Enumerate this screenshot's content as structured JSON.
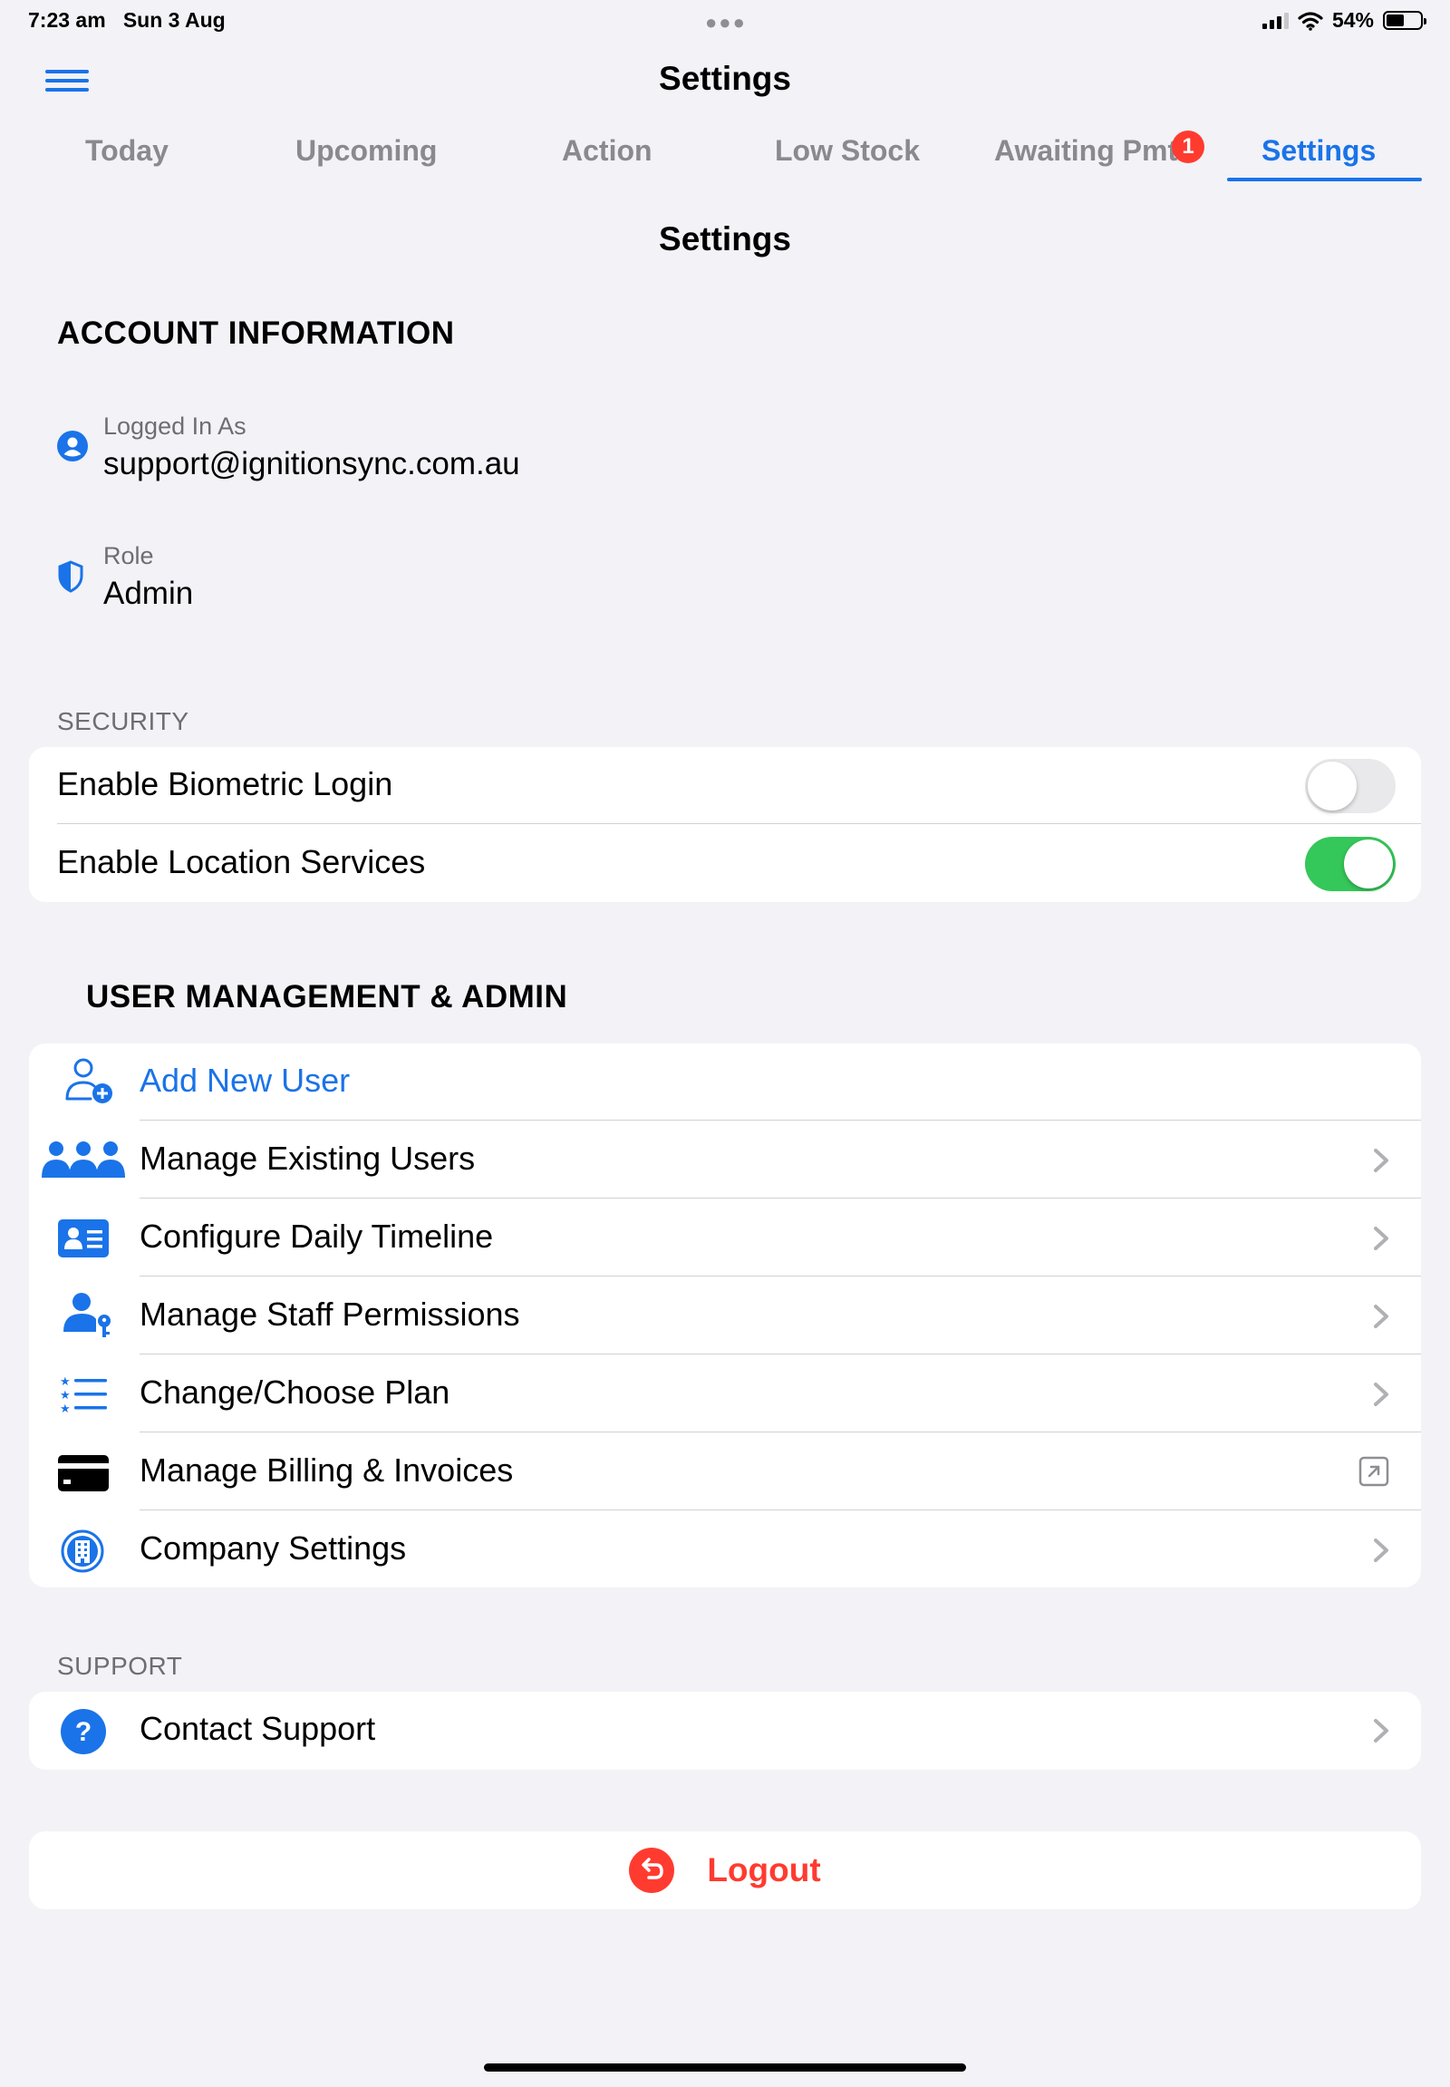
{
  "status_bar": {
    "time": "7:23 am",
    "date": "Sun 3 Aug",
    "battery_percent": "54%",
    "battery_level": 0.54
  },
  "nav": {
    "title": "Settings",
    "menu_icon": "hamburger-icon"
  },
  "tabs": [
    {
      "label": "Today",
      "active": false
    },
    {
      "label": "Upcoming",
      "active": false
    },
    {
      "label": "Action",
      "active": false
    },
    {
      "label": "Low Stock",
      "active": false
    },
    {
      "label": "Awaiting Pmt",
      "active": false,
      "badge": "1"
    },
    {
      "label": "Settings",
      "active": true
    }
  ],
  "page_title": "Settings",
  "account": {
    "heading": "ACCOUNT INFORMATION",
    "logged_in_label": "Logged In As",
    "logged_in_value": "support@ignitionsync.com.au",
    "role_label": "Role",
    "role_value": "Admin"
  },
  "security": {
    "caption": "SECURITY",
    "items": [
      {
        "label": "Enable Biometric Login",
        "enabled": false
      },
      {
        "label": "Enable Location Services",
        "enabled": true
      }
    ]
  },
  "user_management": {
    "heading": "USER MANAGEMENT & ADMIN",
    "items": [
      {
        "label": "Add New User",
        "icon": "add-user-icon",
        "accessory": "none"
      },
      {
        "label": "Manage Existing Users",
        "icon": "users-group-icon",
        "accessory": "chevron"
      },
      {
        "label": "Configure Daily Timeline",
        "icon": "id-card-icon",
        "accessory": "chevron"
      },
      {
        "label": "Manage Staff Permissions",
        "icon": "user-key-icon",
        "accessory": "chevron"
      },
      {
        "label": "Change/Choose Plan",
        "icon": "list-icon",
        "accessory": "chevron"
      },
      {
        "label": "Manage Billing & Invoices",
        "icon": "credit-card-icon",
        "accessory": "external-link"
      },
      {
        "label": "Company Settings",
        "icon": "building-icon",
        "accessory": "chevron"
      }
    ]
  },
  "support": {
    "caption": "SUPPORT",
    "items": [
      {
        "label": "Contact Support",
        "icon": "question-circle-icon",
        "accessory": "chevron"
      }
    ]
  },
  "logout": {
    "label": "Logout",
    "icon": "logout-icon"
  },
  "colors": {
    "accent": "#1a73e8",
    "destructive": "#ff3b30",
    "toggle_on": "#34c759",
    "background": "#f2f2f7"
  }
}
